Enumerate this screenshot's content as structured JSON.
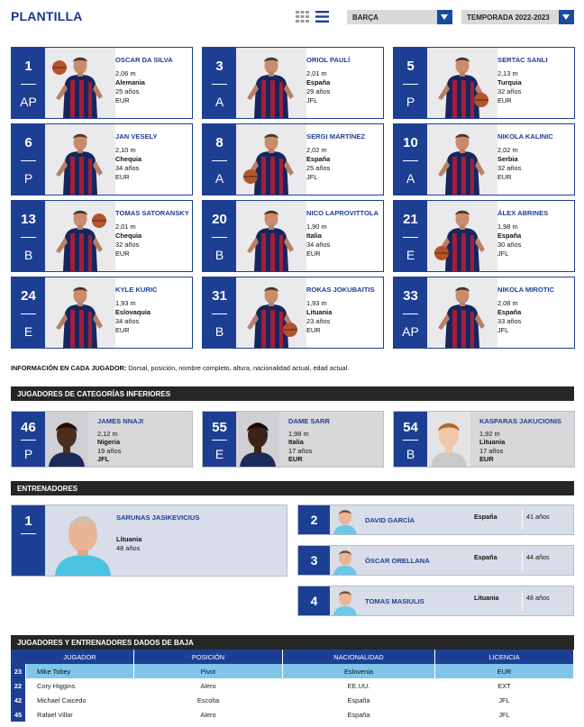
{
  "header": {
    "title": "PLANTILLA",
    "team_select": "BARÇA",
    "season_select": "TEMPORADA 2022-2023"
  },
  "players": [
    {
      "num": "1",
      "pos": "AP",
      "name": "OSCAR DA SILVA",
      "height": "2,06 m",
      "nat": "Alemania",
      "age": "25 años",
      "type": "EUR"
    },
    {
      "num": "3",
      "pos": "A",
      "name": "ORIOL PAULÍ",
      "height": "2,01 m",
      "nat": "España",
      "age": "29 años",
      "type": "JFL"
    },
    {
      "num": "5",
      "pos": "P",
      "name": "SERTAC SANLI",
      "height": "2,13 m",
      "nat": "Turquia",
      "age": "32 años",
      "type": "EUR"
    },
    {
      "num": "6",
      "pos": "P",
      "name": "JAN VESELY",
      "height": "2,10 m",
      "nat": "Chequia",
      "age": "34 años",
      "type": "EUR"
    },
    {
      "num": "8",
      "pos": "A",
      "name": "SERGI MARTÍNEZ",
      "height": "2,02 m",
      "nat": "España",
      "age": "25 años",
      "type": "JFL"
    },
    {
      "num": "10",
      "pos": "A",
      "name": "NIKOLA KALINIC",
      "height": "2,02 m",
      "nat": "Serbia",
      "age": "32 años",
      "type": "EUR"
    },
    {
      "num": "13",
      "pos": "B",
      "name": "TOMAS SATORANSKY",
      "height": "2,01 m",
      "nat": "Chequia",
      "age": "32 años",
      "type": "EUR"
    },
    {
      "num": "20",
      "pos": "B",
      "name": "NICO LAPROVITTOLA",
      "height": "1,90 m",
      "nat": "Italia",
      "age": "34 años",
      "type": "EUR"
    },
    {
      "num": "21",
      "pos": "E",
      "name": "ÁLEX ABRINES",
      "height": "1,98 m",
      "nat": "España",
      "age": "30 años",
      "type": "JFL"
    },
    {
      "num": "24",
      "pos": "E",
      "name": "KYLE KURIC",
      "height": "1,93 m",
      "nat": "Eslovaquia",
      "age": "34 años",
      "type": "EUR"
    },
    {
      "num": "31",
      "pos": "B",
      "name": "ROKAS JOKUBAITIS",
      "height": "1,93 m",
      "nat": "Lituania",
      "age": "23 años",
      "type": "EUR"
    },
    {
      "num": "33",
      "pos": "AP",
      "name": "NIKOLA MIROTIC",
      "height": "2,08 m",
      "nat": "España",
      "age": "33 años",
      "type": "JFL"
    }
  ],
  "note": {
    "label": "INFORMACIÓN EN CADA JUGADOR:",
    "text": " Dorsal, posición, nombre completo, altura, nacionalidad actual, edad actual."
  },
  "youth": {
    "title": "JUGADORES DE CATEGORÍAS INFERIORES",
    "items": [
      {
        "num": "46",
        "pos": "P",
        "name": "JAMES NNAJI",
        "height": "2,12 m",
        "nat": "Nigeria",
        "age": "19 años",
        "type": "JFL"
      },
      {
        "num": "55",
        "pos": "E",
        "name": "DAME SARR",
        "height": "1,98 m",
        "nat": "Italia",
        "age": "17 años",
        "type": "EUR"
      },
      {
        "num": "54",
        "pos": "B",
        "name": "KASPARAS JAKUCIONIS",
        "height": "1,92 m",
        "nat": "Lituania",
        "age": "17 años",
        "type": "EUR"
      }
    ]
  },
  "coaches": {
    "title": "ENTRENADORES",
    "head": {
      "num": "1",
      "name": "SARUNAS JASIKEVICIUS",
      "nat": "Lituania",
      "age": "48 años"
    },
    "assistants": [
      {
        "num": "2",
        "name": "DAVID GARCÍA",
        "nat": "España",
        "age": "41 años"
      },
      {
        "num": "3",
        "name": "ÓSCAR ORELLANA",
        "nat": "España",
        "age": "44 años"
      },
      {
        "num": "4",
        "name": "TOMAS MASIULIS",
        "nat": "Lituania",
        "age": "48 años"
      }
    ]
  },
  "departures": {
    "title": "JUGADORES Y ENTRENADORES DADOS DE BAJA",
    "columns": [
      "JUGADOR",
      "POSICIÓN",
      "NACIONALIDAD",
      "LICENCIA"
    ],
    "rows": [
      {
        "num": "23",
        "name": "Mike Tobey",
        "pos": "Pivot",
        "nat": "Eslovenia",
        "lic": "EUR"
      },
      {
        "num": "22",
        "name": "Cory Higgins",
        "pos": "Alero",
        "nat": "EE.UU.",
        "lic": "EXT"
      },
      {
        "num": "42",
        "name": "Michael Caicedo",
        "pos": "Escolta",
        "nat": "España",
        "lic": "JFL"
      },
      {
        "num": "45",
        "name": "Rafael Villar",
        "pos": "Alero",
        "nat": "España",
        "lic": "JFL"
      }
    ]
  }
}
